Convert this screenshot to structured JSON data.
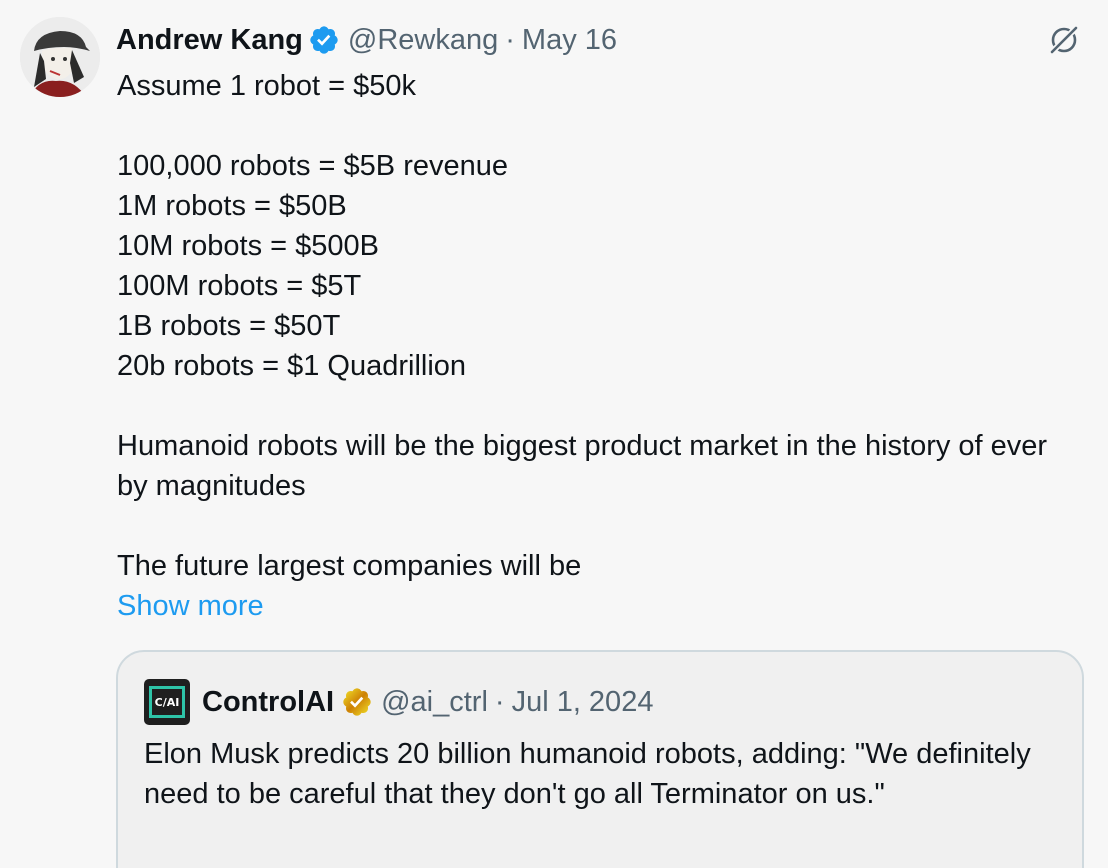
{
  "tweet": {
    "author_name": "Andrew Kang",
    "handle": "@Rewkang",
    "separator": "·",
    "date": "May 16",
    "lines": [
      "Assume 1 robot = $50k",
      "",
      "100,000 robots = $5B revenue",
      "1M robots = $50B",
      "10M robots = $500B",
      "100M robots = $5T",
      "1B robots = $50T",
      "20b robots = $1 Quadrillion",
      "",
      "Humanoid robots will be the biggest product market in the history of ever by magnitudes",
      "",
      "The future largest companies will be"
    ],
    "show_more": "Show more"
  },
  "quote": {
    "author_name": "ControlAI",
    "avatar_text": "C/AI",
    "handle": "@ai_ctrl",
    "separator": "·",
    "date": "Jul 1, 2024",
    "text": "Elon Musk predicts 20 billion humanoid robots, adding: \"We definitely need to be careful that they don't go all Terminator on us.\""
  },
  "colors": {
    "link": "#1d9bf0",
    "secondary_text": "#536471",
    "verified_blue": "#1d9bf0",
    "verified_gold": "#e2b719",
    "background": "#f7f7f7"
  },
  "icons": {
    "verified": "verified-badge-icon",
    "verified_org": "gold-verified-badge-icon",
    "grok": "grok-icon"
  }
}
